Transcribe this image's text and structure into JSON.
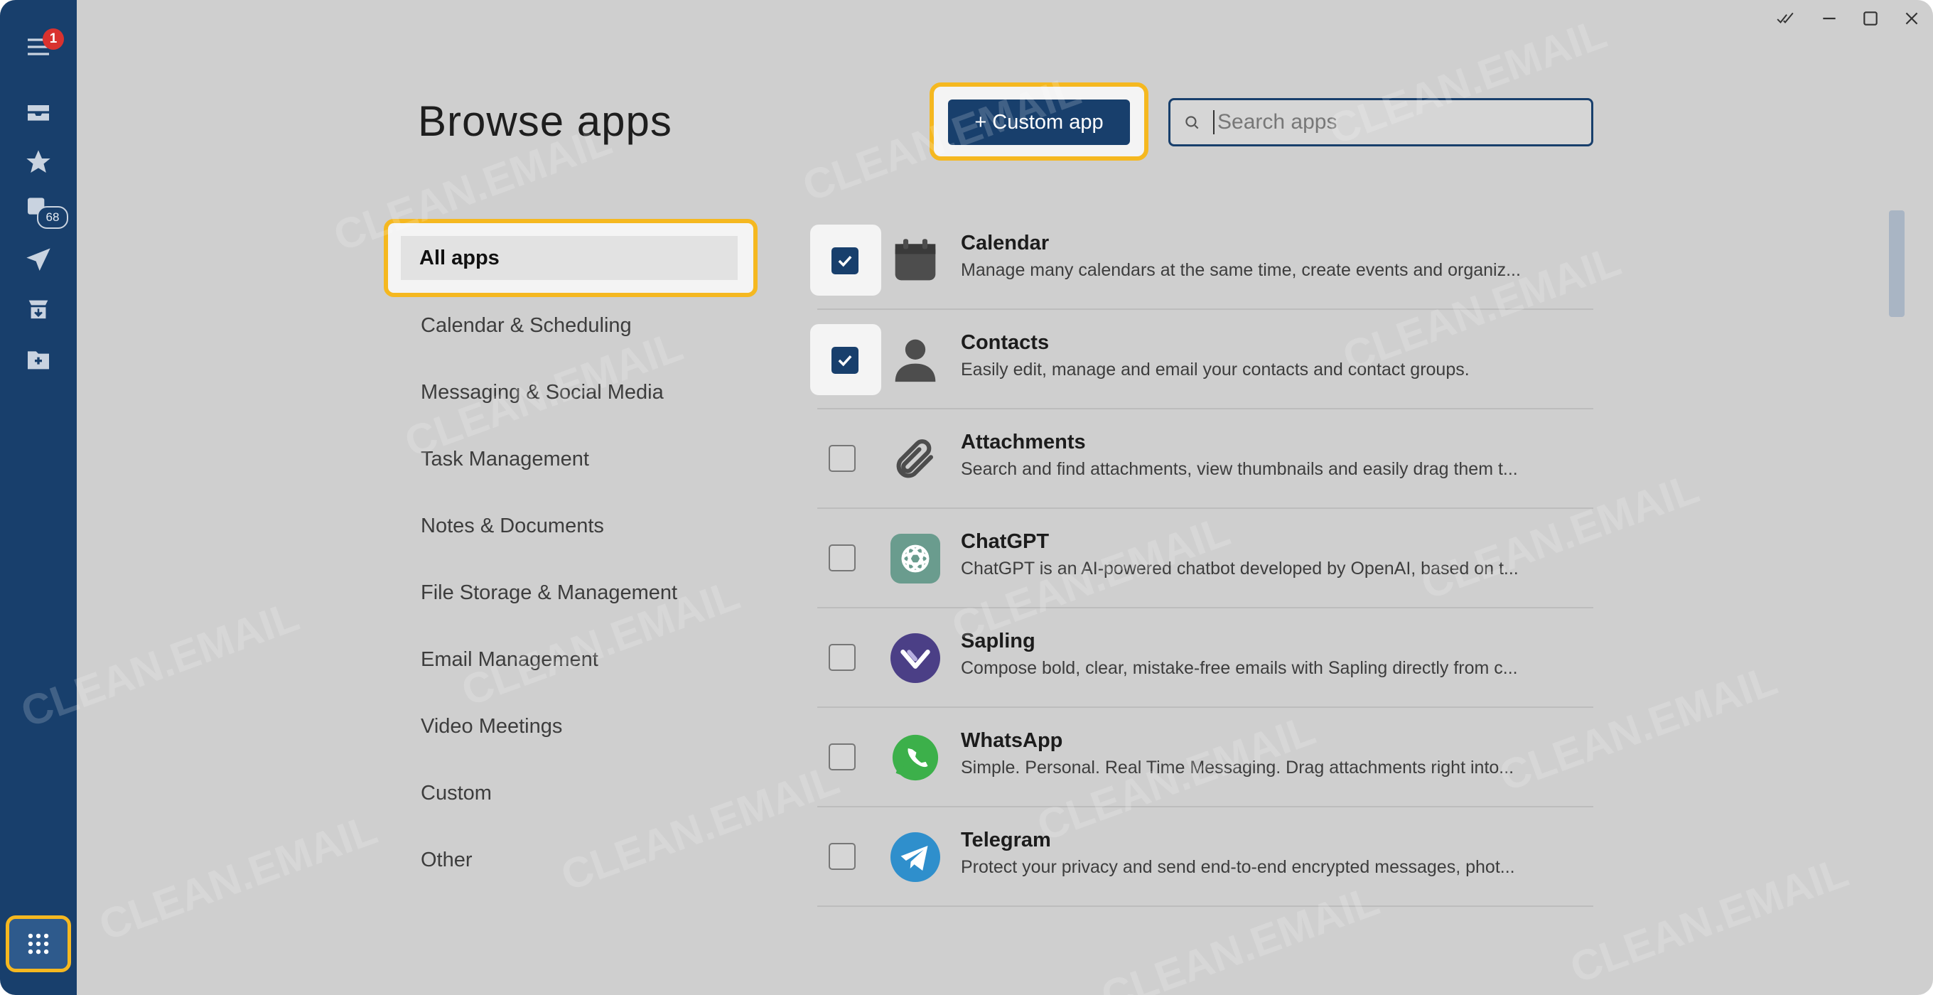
{
  "window": {
    "controls": [
      "mark-all-read",
      "minimize",
      "maximize",
      "close"
    ]
  },
  "sidebar": {
    "menu_badge": "1",
    "inbox_count": "68",
    "icons": [
      "menu-icon",
      "inbox-icon",
      "star-icon",
      "calendar-icon",
      "send-icon",
      "archive-icon",
      "folder-add-icon",
      "apps-grid-icon"
    ]
  },
  "header": {
    "title": "Browse apps",
    "custom_app_label": "+ Custom app",
    "search_placeholder": "Search apps"
  },
  "categories": {
    "active": "All apps",
    "items": [
      "Calendar & Scheduling",
      "Messaging & Social Media",
      "Task Management",
      "Notes & Documents",
      "File Storage & Management",
      "Email Management",
      "Video Meetings",
      "Custom",
      "Other"
    ]
  },
  "apps": [
    {
      "name": "Calendar",
      "description": "Manage many calendars at the same time, create events and organiz...",
      "checked": true,
      "icon": "calendar-icon"
    },
    {
      "name": "Contacts",
      "description": "Easily edit, manage and email your contacts and contact groups.",
      "checked": true,
      "icon": "person-icon"
    },
    {
      "name": "Attachments",
      "description": "Search and find attachments, view thumbnails and easily drag them t...",
      "checked": false,
      "icon": "paperclip-icon"
    },
    {
      "name": "ChatGPT",
      "description": "ChatGPT is an AI-powered chatbot developed by OpenAI, based on t...",
      "checked": false,
      "icon": "chatgpt-icon"
    },
    {
      "name": "Sapling",
      "description": "Compose bold, clear, mistake-free emails with Sapling directly from c...",
      "checked": false,
      "icon": "sapling-icon"
    },
    {
      "name": "WhatsApp",
      "description": "Simple. Personal. Real Time Messaging. Drag attachments right into...",
      "checked": false,
      "icon": "whatsapp-icon"
    },
    {
      "name": "Telegram",
      "description": "Protect your privacy and send end-to-end encrypted messages, phot...",
      "checked": false,
      "icon": "telegram-icon"
    }
  ],
  "watermark": "CLEAN.EMAIL",
  "colors": {
    "accent": "#183f6c",
    "highlight": "#f5b820",
    "badge": "#d9322f"
  }
}
